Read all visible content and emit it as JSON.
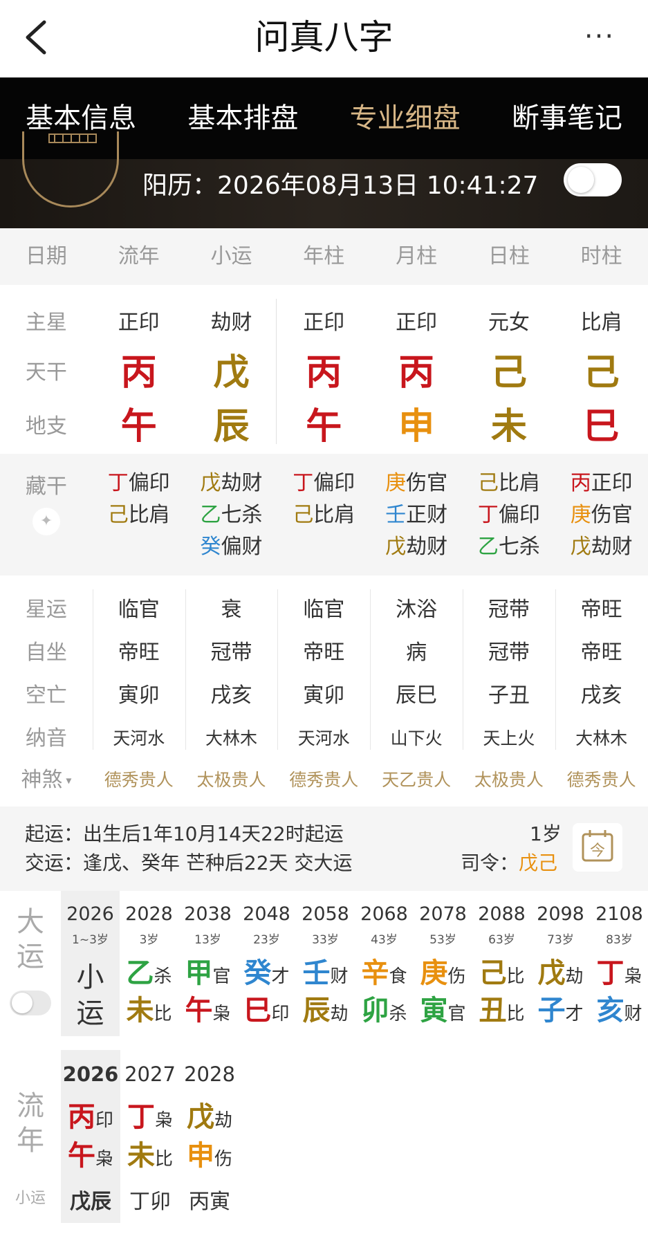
{
  "top": {
    "title": "问真八字",
    "more": "···"
  },
  "tabs": [
    "基本信息",
    "基本排盘",
    "专业细盘",
    "断事笔记"
  ],
  "active_tab": 2,
  "solar": {
    "label": "阳历：",
    "value": "2026年08月13日 10:41:27"
  },
  "columns": [
    "日期",
    "流年",
    "小运",
    "年柱",
    "月柱",
    "日柱",
    "时柱"
  ],
  "pillars": {
    "star_label": "主星",
    "stars": [
      "正印",
      "劫财",
      "正印",
      "正印",
      "元女",
      "比肩"
    ],
    "gan_label": "天干",
    "gan": [
      {
        "c": "丙",
        "col": "red"
      },
      {
        "c": "戊",
        "col": "gold"
      },
      {
        "c": "丙",
        "col": "red"
      },
      {
        "c": "丙",
        "col": "red"
      },
      {
        "c": "己",
        "col": "gold"
      },
      {
        "c": "己",
        "col": "gold"
      }
    ],
    "zhi_label": "地支",
    "zhi": [
      {
        "c": "午",
        "col": "red"
      },
      {
        "c": "辰",
        "col": "gold"
      },
      {
        "c": "午",
        "col": "red"
      },
      {
        "c": "申",
        "col": "orange"
      },
      {
        "c": "未",
        "col": "gold"
      },
      {
        "c": "巳",
        "col": "red"
      }
    ]
  },
  "hidden": {
    "label": "藏干",
    "cols": [
      [
        {
          "g": "丁",
          "col": "red",
          "s": "偏印"
        },
        {
          "g": "己",
          "col": "gold",
          "s": "比肩"
        }
      ],
      [
        {
          "g": "戊",
          "col": "gold",
          "s": "劫财"
        },
        {
          "g": "乙",
          "col": "green",
          "s": "七杀"
        },
        {
          "g": "癸",
          "col": "blue",
          "s": "偏财"
        }
      ],
      [
        {
          "g": "丁",
          "col": "red",
          "s": "偏印"
        },
        {
          "g": "己",
          "col": "gold",
          "s": "比肩"
        }
      ],
      [
        {
          "g": "庚",
          "col": "orange",
          "s": "伤官"
        },
        {
          "g": "壬",
          "col": "blue",
          "s": "正财"
        },
        {
          "g": "戊",
          "col": "gold",
          "s": "劫财"
        }
      ],
      [
        {
          "g": "己",
          "col": "gold",
          "s": "比肩"
        },
        {
          "g": "丁",
          "col": "red",
          "s": "偏印"
        },
        {
          "g": "乙",
          "col": "green",
          "s": "七杀"
        }
      ],
      [
        {
          "g": "丙",
          "col": "red",
          "s": "正印"
        },
        {
          "g": "庚",
          "col": "orange",
          "s": "伤官"
        },
        {
          "g": "戊",
          "col": "gold",
          "s": "劫财"
        }
      ]
    ]
  },
  "fate": {
    "xingyun": {
      "label": "星运",
      "values": [
        "临官",
        "衰",
        "临官",
        "沐浴",
        "冠带",
        "帝旺"
      ]
    },
    "zizuo": {
      "label": "自坐",
      "values": [
        "帝旺",
        "冠带",
        "帝旺",
        "病",
        "冠带",
        "帝旺"
      ]
    },
    "kongwang": {
      "label": "空亡",
      "values": [
        "寅卯",
        "戌亥",
        "寅卯",
        "辰巳",
        "子丑",
        "戌亥"
      ]
    },
    "nayin": {
      "label": "纳音",
      "values": [
        "天河水",
        "大林木",
        "天河水",
        "山下火",
        "天上火",
        "大林木"
      ]
    },
    "shensha": {
      "label": "神煞",
      "values": [
        "德秀贵人",
        "太极贵人",
        "德秀贵人",
        "天乙贵人",
        "太极贵人",
        "德秀贵人"
      ]
    }
  },
  "qiyun": {
    "label1": "起运：",
    "text1": "出生后1年10月14天22时起运",
    "label2": "交运：",
    "text2": "逢戊、癸年 芒种后22天 交大运",
    "age": "1岁",
    "siling_label": "司令：",
    "siling": "戊己",
    "cal_icon": "今"
  },
  "dayun": {
    "label": [
      "大",
      "运"
    ],
    "first": {
      "year": "2026",
      "age": "1~3岁",
      "text": [
        "小",
        "运"
      ]
    },
    "items": [
      {
        "year": "2028",
        "age": "3岁",
        "g": "乙",
        "gc": "green",
        "gs": "杀",
        "z": "未",
        "zc": "gold",
        "zs": "比"
      },
      {
        "year": "2038",
        "age": "13岁",
        "g": "甲",
        "gc": "green",
        "gs": "官",
        "z": "午",
        "zc": "red",
        "zs": "枭"
      },
      {
        "year": "2048",
        "age": "23岁",
        "g": "癸",
        "gc": "blue",
        "gs": "才",
        "z": "巳",
        "zc": "red",
        "zs": "印"
      },
      {
        "year": "2058",
        "age": "33岁",
        "g": "壬",
        "gc": "blue",
        "gs": "财",
        "z": "辰",
        "zc": "gold",
        "zs": "劫"
      },
      {
        "year": "2068",
        "age": "43岁",
        "g": "辛",
        "gc": "orange",
        "gs": "食",
        "z": "卯",
        "zc": "green",
        "zs": "杀"
      },
      {
        "year": "2078",
        "age": "53岁",
        "g": "庚",
        "gc": "orange",
        "gs": "伤",
        "z": "寅",
        "zc": "green",
        "zs": "官"
      },
      {
        "year": "2088",
        "age": "63岁",
        "g": "己",
        "gc": "gold",
        "gs": "比",
        "z": "丑",
        "zc": "gold",
        "zs": "比"
      },
      {
        "year": "2098",
        "age": "73岁",
        "g": "戊",
        "gc": "gold",
        "gs": "劫",
        "z": "子",
        "zc": "blue",
        "zs": "才"
      },
      {
        "year": "2108",
        "age": "83岁",
        "g": "丁",
        "gc": "red",
        "gs": "枭",
        "z": "亥",
        "zc": "blue",
        "zs": "财"
      }
    ]
  },
  "liunian": {
    "label": [
      "流",
      "年"
    ],
    "sub_label": "小运",
    "items": [
      {
        "year": "2026",
        "g": "丙",
        "gc": "red",
        "gs": "印",
        "z": "午",
        "zc": "red",
        "zs": "枭",
        "xy": "戊辰",
        "sel": true
      },
      {
        "year": "2027",
        "g": "丁",
        "gc": "red",
        "gs": "枭",
        "z": "未",
        "zc": "gold",
        "zs": "比",
        "xy": "丁卯",
        "sel": false
      },
      {
        "year": "2028",
        "g": "戊",
        "gc": "gold",
        "gs": "劫",
        "z": "申",
        "zc": "orange",
        "zs": "伤",
        "xy": "丙寅",
        "sel": false
      }
    ]
  }
}
